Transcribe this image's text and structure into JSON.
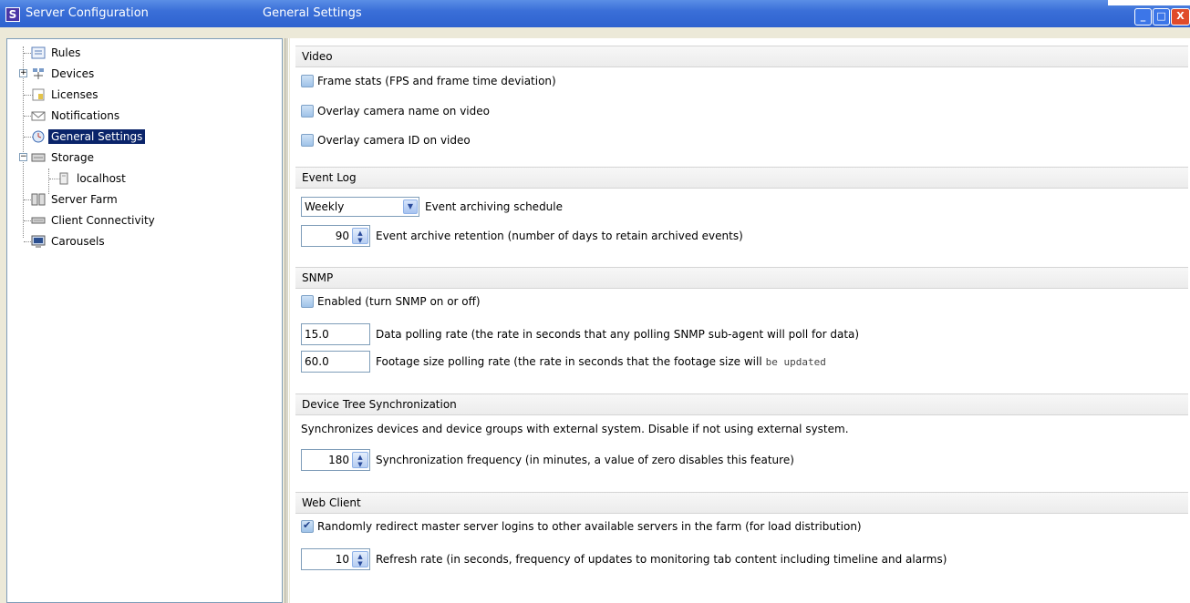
{
  "window": {
    "app_title": "Server Configuration",
    "page_title": "General Settings",
    "app_icon_letter": "S",
    "controls": {
      "minimize": "_",
      "maximize": "□",
      "close": "X"
    }
  },
  "tree": {
    "items": [
      {
        "label": "Rules",
        "icon": "rules-icon"
      },
      {
        "label": "Devices",
        "icon": "devices-icon",
        "expander": "+"
      },
      {
        "label": "Licenses",
        "icon": "licenses-icon"
      },
      {
        "label": "Notifications",
        "icon": "notifications-icon"
      },
      {
        "label": "General Settings",
        "icon": "general-settings-icon",
        "selected": true
      },
      {
        "label": "Storage",
        "icon": "storage-icon",
        "expander": "−"
      },
      {
        "label": "localhost",
        "icon": "server-icon"
      },
      {
        "label": "Server Farm",
        "icon": "server-farm-icon"
      },
      {
        "label": "Client Connectivity",
        "icon": "client-connectivity-icon"
      },
      {
        "label": "Carousels",
        "icon": "carousels-icon"
      }
    ]
  },
  "video": {
    "title": "Video",
    "frame_stats": {
      "label": "Frame stats (FPS and frame time deviation)",
      "checked": false
    },
    "overlay_name": {
      "label": "Overlay camera name on video",
      "checked": false
    },
    "overlay_id": {
      "label": "Overlay camera ID on video",
      "checked": false
    }
  },
  "event_log": {
    "title": "Event Log",
    "schedule_value": "Weekly",
    "schedule_label": "Event archiving schedule",
    "retention_value": "90",
    "retention_label": "Event archive retention (number of days to retain archived events)"
  },
  "snmp": {
    "title": "SNMP",
    "enabled_label": "Enabled (turn SNMP on or off)",
    "enabled_checked": false,
    "polling_value": "15.0",
    "polling_label": "Data polling rate (the rate in seconds that any polling SNMP sub-agent will poll for data)",
    "footage_value": "60.0",
    "footage_label": "Footage size polling rate (the rate in seconds that the footage size will",
    "footage_label_tail": "be updated"
  },
  "device_tree": {
    "title": "Device Tree Synchronization",
    "description": "Synchronizes devices and device groups with external system. Disable if not using external system.",
    "frequency_value": "180",
    "frequency_label": "Synchronization frequency (in minutes, a value of zero disables this feature)"
  },
  "web_client": {
    "title": "Web Client",
    "redirect_label": "Randomly redirect master server logins to other available servers in the farm (for load distribution)",
    "redirect_checked": true,
    "refresh_value": "10",
    "refresh_label": "Refresh rate (in seconds, frequency of updates to monitoring tab content including timeline and alarms)"
  },
  "colors": {
    "titlebar": "#2e62cf",
    "selection": "#0a246a",
    "close_button": "#e04b2a"
  }
}
